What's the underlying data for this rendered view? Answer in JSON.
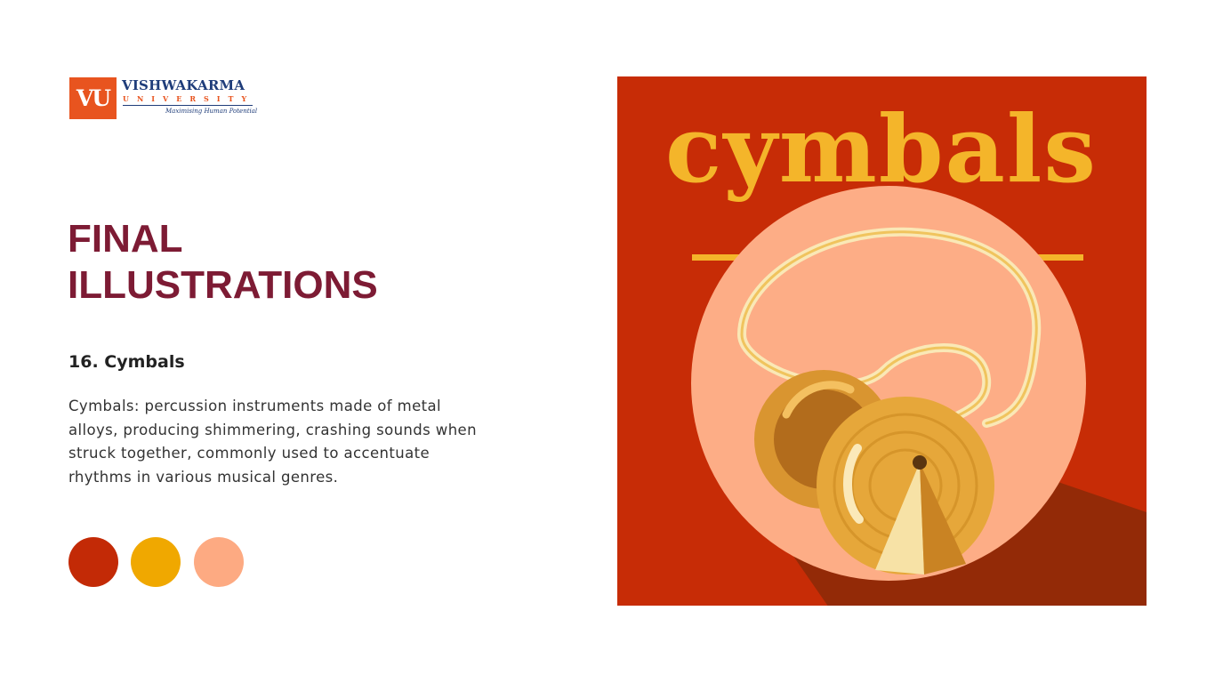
{
  "logo": {
    "mark": "VU",
    "name": "VISHWAKARMA",
    "sub": "UNIVERSITY",
    "tagline": "Maximising Human Potential"
  },
  "slide": {
    "title_line1": "FINAL",
    "title_line2": "ILLUSTRATIONS",
    "subtitle": "16. Cymbals",
    "description": "Cymbals: percussion instruments made of metal alloys, producing shimmering, crashing sounds when struck together, commonly used to accentuate rhythms in various musical genres."
  },
  "palette": [
    "#c32a06",
    "#f0a800",
    "#fdaa82"
  ],
  "illustration": {
    "word": "cymbals",
    "colors": {
      "background": "#c72c06",
      "circle": "#fdad86",
      "lettering": "#f4b52a",
      "shadow": "#8a2a08"
    }
  }
}
